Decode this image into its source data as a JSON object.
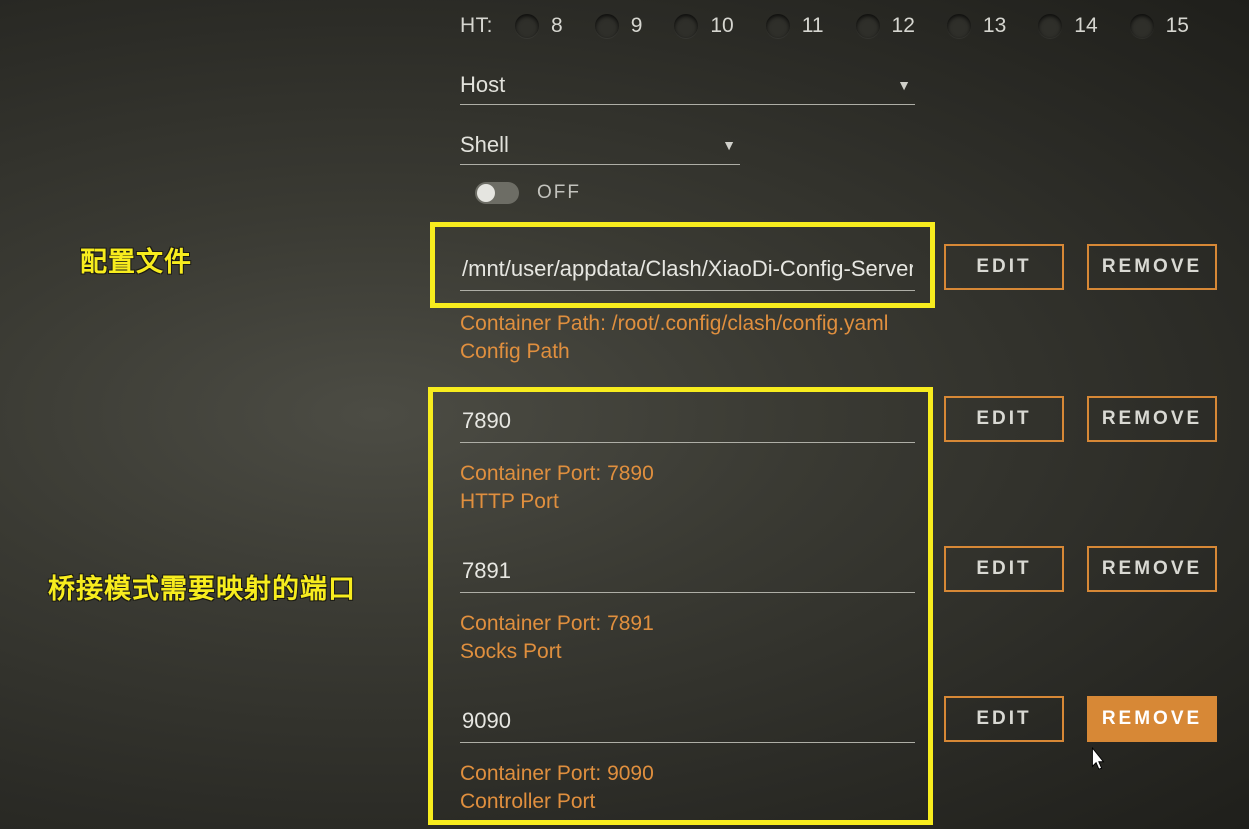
{
  "ht": {
    "label": "HT:",
    "values": [
      "8",
      "9",
      "10",
      "11",
      "12",
      "13",
      "14",
      "15"
    ]
  },
  "selects": {
    "host": "Host",
    "shell": "Shell"
  },
  "toggle": {
    "state": "OFF"
  },
  "config": {
    "path_value": "/mnt/user/appdata/Clash/XiaoDi-Config-Server.ym",
    "container_path": "Container Path: /root/.config/clash/config.yaml",
    "desc": "Config Path"
  },
  "ports": [
    {
      "value": "7890",
      "container": "Container Port: 7890",
      "desc": "HTTP Port"
    },
    {
      "value": "7891",
      "container": "Container Port: 7891",
      "desc": "Socks Port"
    },
    {
      "value": "9090",
      "container": "Container Port: 9090",
      "desc": "Controller Port"
    }
  ],
  "buttons": {
    "edit": "EDIT",
    "remove": "REMOVE"
  },
  "annotations": {
    "config": "配置文件",
    "ports": "桥接模式需要映射的端口"
  }
}
